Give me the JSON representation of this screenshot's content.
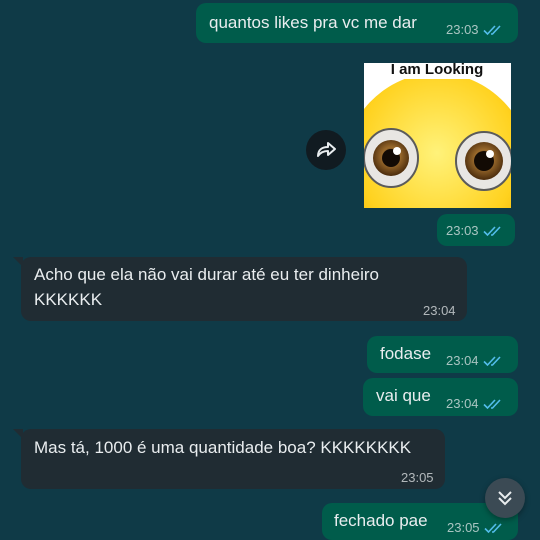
{
  "messages": [
    {
      "text": "quantos likes pra vc me dar",
      "time": "23:03"
    },
    {
      "sticker_caption": "I am Looking",
      "time": "23:03"
    },
    {
      "lines": [
        "Acho que ela não vai durar até eu ter dinheiro",
        "KKKKKK"
      ],
      "time": "23:04"
    },
    {
      "text": "fodase",
      "time": "23:04"
    },
    {
      "text": "vai que",
      "time": "23:04"
    },
    {
      "text": "Mas tá, 1000 é uma quantidade boa? KKKKKKKK",
      "time": "23:05"
    },
    {
      "text": "fechado pae",
      "time": "23:05"
    }
  ],
  "colors": {
    "background": "#0f3a47",
    "outgoing_bubble": "#005c4b",
    "incoming_bubble": "#202c33",
    "read_ticks": "#53bdeb"
  },
  "icons": {
    "read_receipt": "double-check-icon",
    "forward": "forward-arrow-icon",
    "scroll_down": "chevron-double-down-icon"
  }
}
